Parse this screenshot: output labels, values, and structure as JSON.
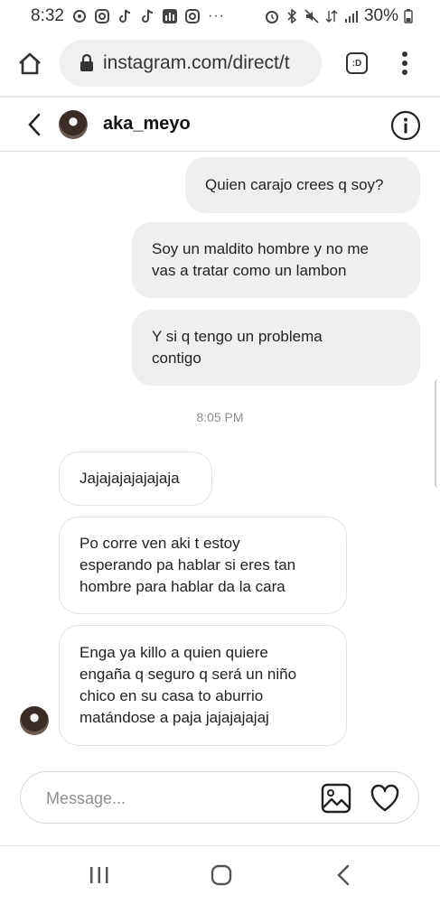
{
  "status": {
    "time": "8:32",
    "battery": "30%"
  },
  "browser": {
    "url": "instagram.com/direct/t",
    "tab_label": ":D"
  },
  "chat": {
    "username": "aka_meyo"
  },
  "messages_sent": [
    {
      "lines": [
        "Quien carajo crees q soy?"
      ]
    },
    {
      "lines": [
        "Soy un maldito hombre y no me",
        "vas a tratar como un lambon"
      ]
    },
    {
      "lines": [
        "Y si q tengo un problema",
        "contigo"
      ]
    }
  ],
  "timestamp": "8:05 PM",
  "messages_received": [
    {
      "lines": [
        "Jajajajajajajaja"
      ]
    },
    {
      "lines": [
        "Po corre ven aki t estoy",
        "esperando pa hablar si eres tan",
        "hombre para hablar da la cara"
      ]
    },
    {
      "lines": [
        "Enga ya killo a quien quiere",
        "engaña q seguro q será un niño",
        "chico en su casa to aburrio",
        "matándose a paja jajajajajaj"
      ]
    }
  ],
  "composer": {
    "placeholder": "Message..."
  },
  "icons": {
    "back": "chevron-left-icon",
    "info": "info-icon",
    "home": "home-icon",
    "lock": "lock-icon",
    "menu": "more-vert-icon",
    "image": "image-icon",
    "heart": "heart-icon"
  }
}
